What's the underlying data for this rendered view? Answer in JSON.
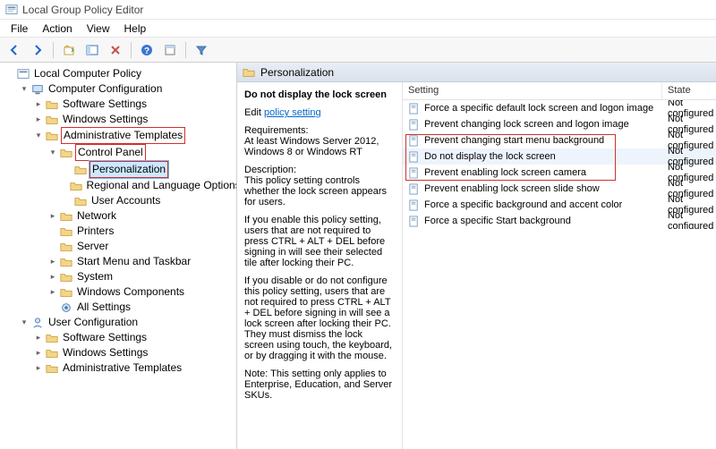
{
  "window": {
    "title": "Local Group Policy Editor"
  },
  "menu": {
    "file": "File",
    "action": "Action",
    "view": "View",
    "help": "Help"
  },
  "tree": {
    "root": "Local Computer Policy",
    "comp_cfg": "Computer Configuration",
    "software": "Software Settings",
    "windows_settings": "Windows Settings",
    "admin_templates": "Administrative Templates",
    "control_panel": "Control Panel",
    "personalization": "Personalization",
    "regional": "Regional and Language Options",
    "user_accounts": "User Accounts",
    "network": "Network",
    "printers": "Printers",
    "server": "Server",
    "start_menu": "Start Menu and Taskbar",
    "system": "System",
    "win_components": "Windows Components",
    "all_settings": "All Settings",
    "user_cfg": "User Configuration",
    "u_software": "Software Settings",
    "u_windows": "Windows Settings",
    "u_admin": "Administrative Templates"
  },
  "detail": {
    "header": "Personalization",
    "policy_title": "Do not display the lock screen",
    "edit_prefix": "Edit ",
    "edit_link": "policy setting",
    "req_label": "Requirements:",
    "req_text": "At least Windows Server 2012, Windows 8 or Windows RT",
    "desc_label": "Description:",
    "desc_1": "This policy setting controls whether the lock screen appears for users.",
    "desc_2": "If you enable this policy setting, users that are not required to press CTRL + ALT + DEL before signing in will see their selected tile after locking their PC.",
    "desc_3": "If you disable or do not configure this policy setting, users that are not required to press CTRL + ALT + DEL before signing in will see a lock screen after locking their PC. They must dismiss the lock screen using touch, the keyboard, or by dragging it with the mouse.",
    "desc_4": "Note: This setting only applies to Enterprise, Education, and Server SKUs."
  },
  "columns": {
    "setting": "Setting",
    "state": "State"
  },
  "policies": [
    {
      "name": "Force a specific default lock screen and logon image",
      "state": "Not configured"
    },
    {
      "name": "Prevent changing lock screen and logon image",
      "state": "Not configured"
    },
    {
      "name": "Prevent changing start menu background",
      "state": "Not configured"
    },
    {
      "name": "Do not display the lock screen",
      "state": "Not configured"
    },
    {
      "name": "Prevent enabling lock screen camera",
      "state": "Not configured"
    },
    {
      "name": "Prevent enabling lock screen slide show",
      "state": "Not configured"
    },
    {
      "name": "Force a specific background and accent color",
      "state": "Not configured"
    },
    {
      "name": "Force a specific Start background",
      "state": "Not configured"
    }
  ]
}
